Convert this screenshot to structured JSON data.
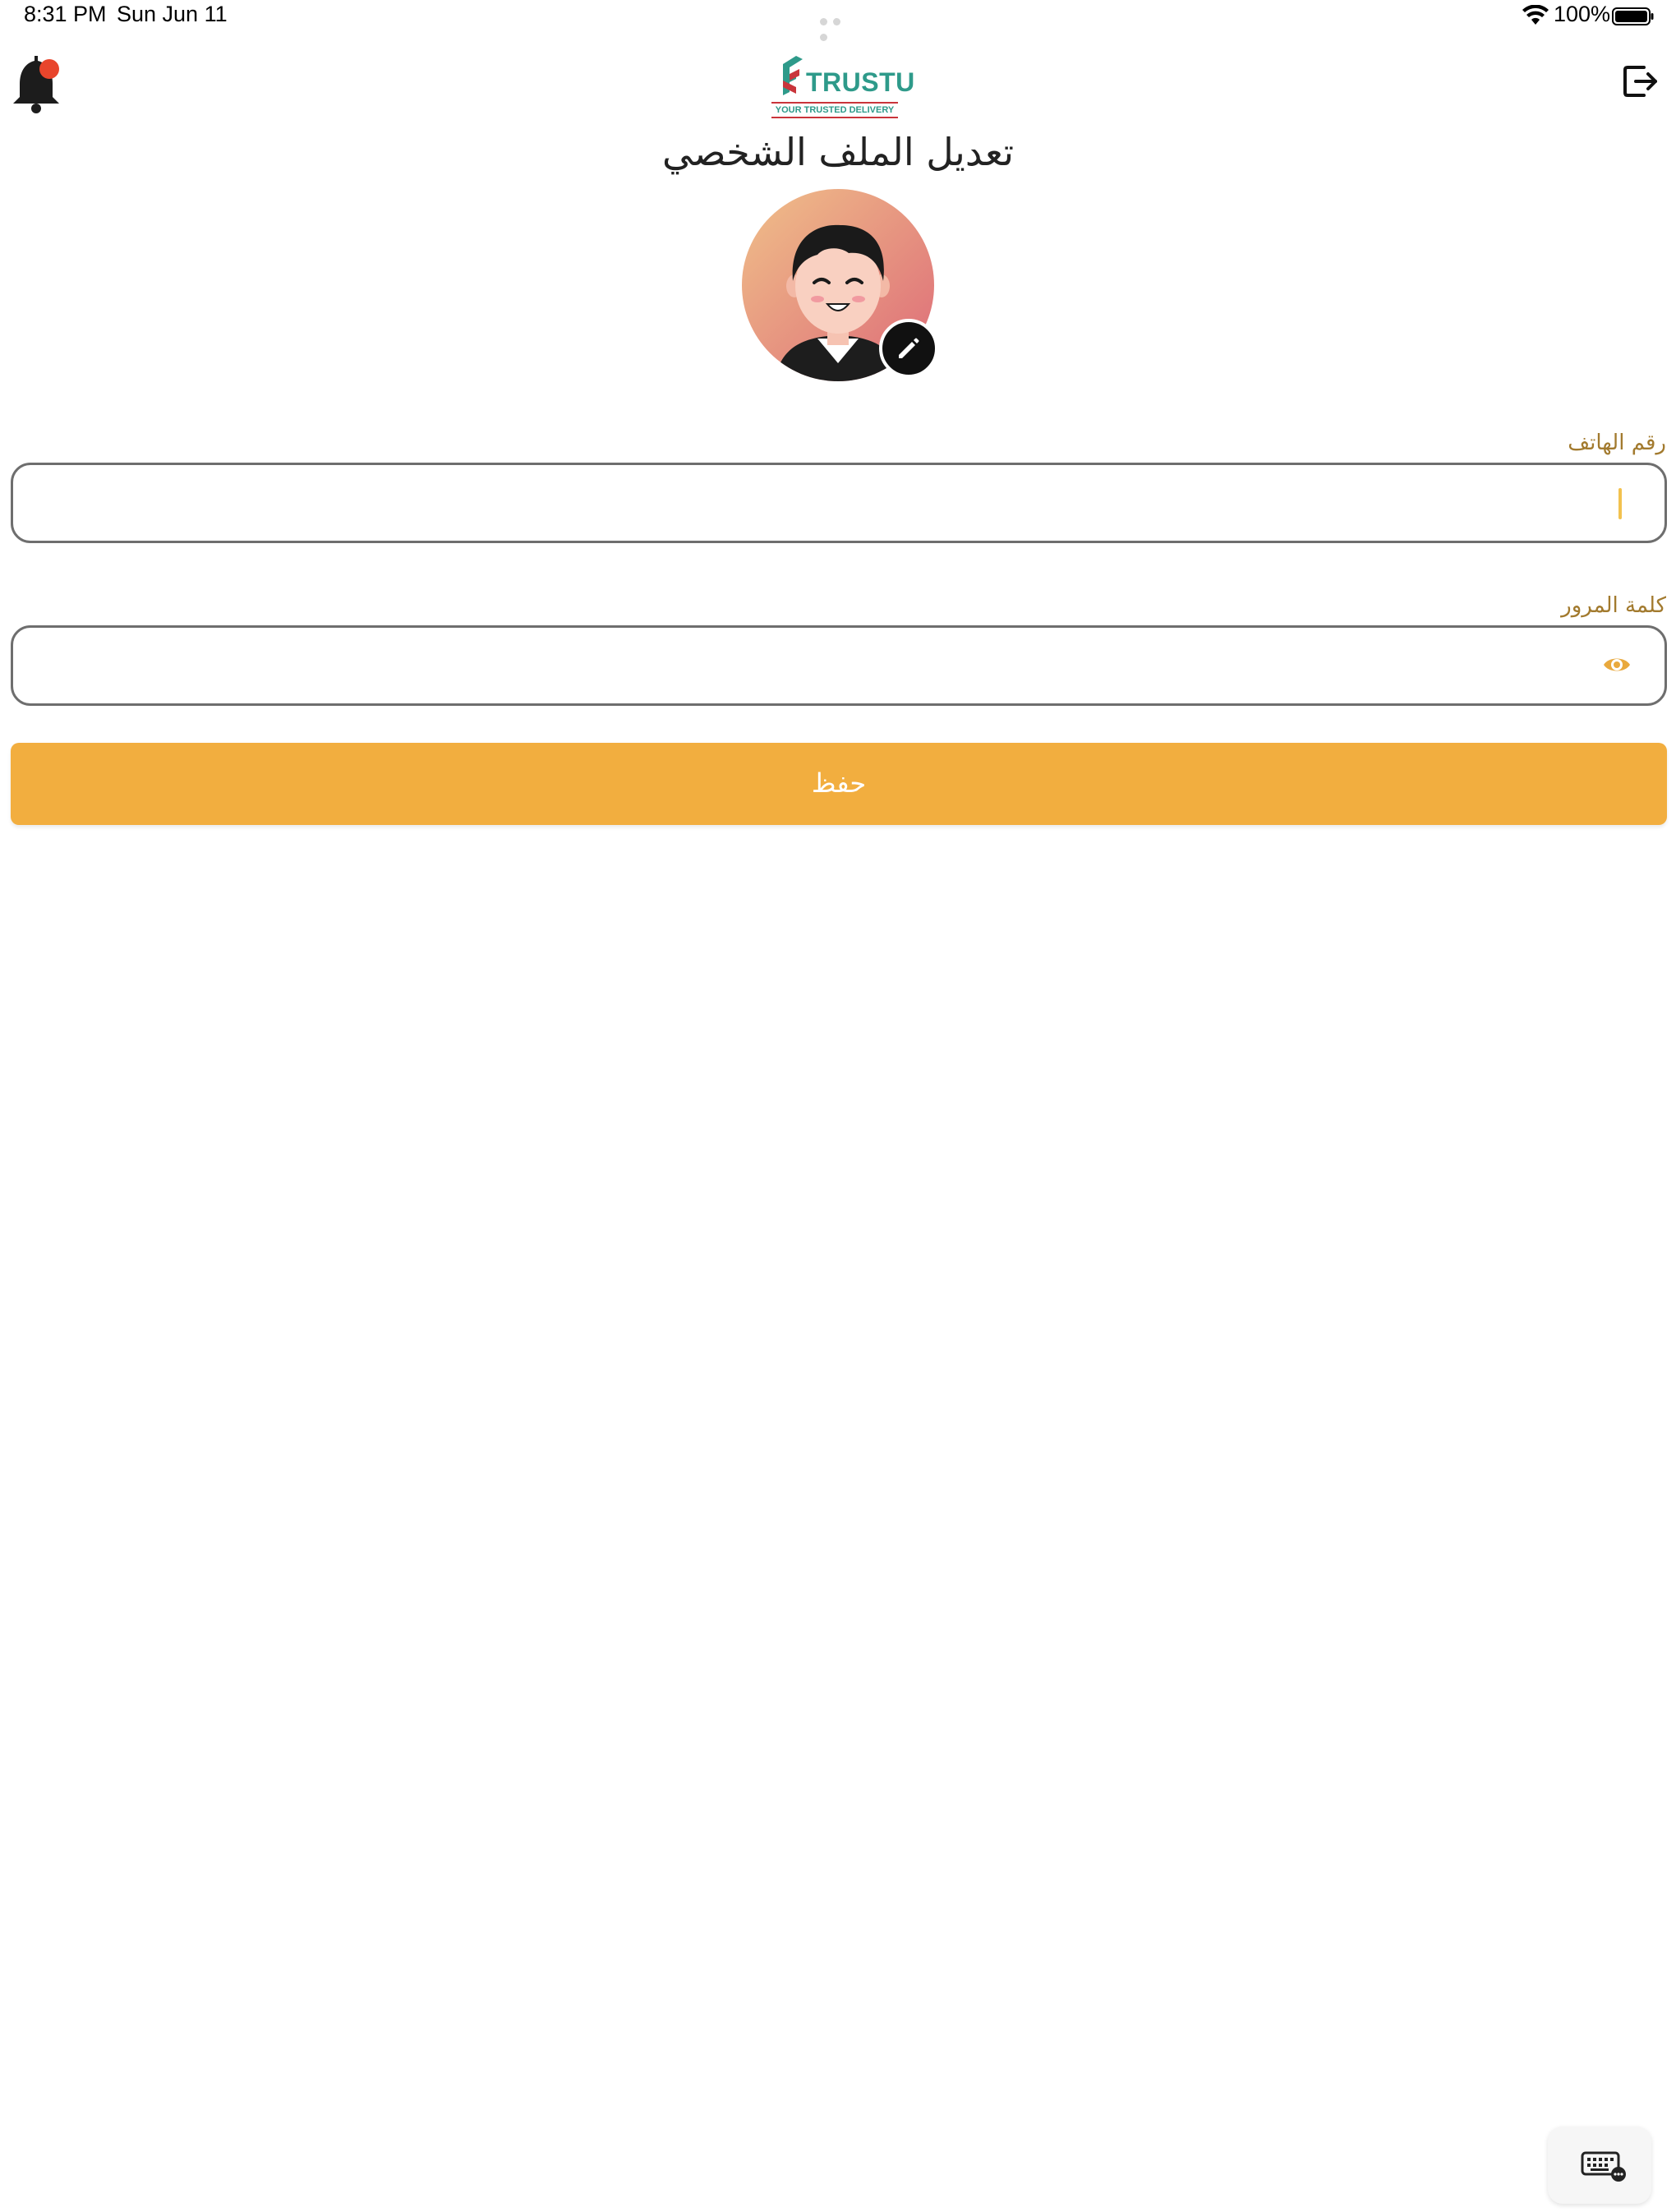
{
  "status_bar": {
    "time": "8:31 PM",
    "date": "Sun Jun 11",
    "battery_text": "100%",
    "battery_level": 1.0
  },
  "header": {
    "logo": {
      "wordmark": "TRUSTU",
      "tagline": "YOUR TRUSTED DELIVERY"
    },
    "notification_icon": "bell-icon",
    "logout_icon": "logout-icon"
  },
  "page": {
    "title": "تعديل الملف الشخصي",
    "avatar_icon": "avatar",
    "edit_icon": "pencil-icon"
  },
  "form": {
    "phone": {
      "label": "رقم الهاتف",
      "value": ""
    },
    "password": {
      "label": "كلمة المرور",
      "value": "",
      "toggle_icon": "eye-icon"
    },
    "save_label": "حفظ"
  },
  "colors": {
    "accent": "#f2ae3f",
    "label": "#a27a2e",
    "notification_dot": "#e8452c",
    "logo_teal": "#2e9a8a",
    "logo_red": "#c9353b"
  },
  "keyboard_button_icon": "keyboard-icon"
}
